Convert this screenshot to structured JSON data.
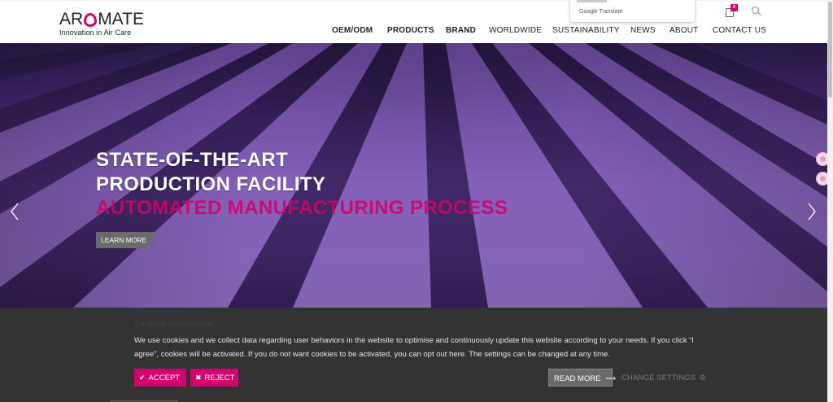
{
  "brand": {
    "logo_left": "AR",
    "logo_right": "MATE",
    "tagline": "Innovation in Air Care",
    "accent_color": "#d4006d"
  },
  "translate_popup": {
    "label": "Google Translate"
  },
  "header": {
    "cart_count": "0",
    "cart_icon": "cart-icon",
    "search_icon": "search-icon"
  },
  "nav": {
    "items": [
      {
        "label": "OEM/ODM"
      },
      {
        "label": "PRODUCTS"
      },
      {
        "label": "BRAND"
      },
      {
        "label": "WORLDWIDE"
      },
      {
        "label": "SUSTAINABILITY"
      },
      {
        "label": "NEWS"
      },
      {
        "label": "ABOUT"
      },
      {
        "label": "CONTACT US"
      }
    ]
  },
  "hero": {
    "title_line1": "STATE-OF-THE-ART",
    "title_line2": "PRODUCTION FACILITY",
    "subtitle": "AUTOMATED MANUFACTURING PROCESS",
    "cta": "LEARN MORE",
    "prev_icon": "chevron-left-icon",
    "next_icon": "chevron-right-icon"
  },
  "cookies": {
    "title": "Cookies Information",
    "text": "We use cookies and we collect data regarding user behaviors in the website to optimise and continuously update this website according to your needs. If you click “I agree”, cookies will be activated. If you do not want cookies to be activated, you can opt out here. The settings can be changed at any time.",
    "accept": "ACCEPT",
    "reject": "REJECT",
    "read_more": "READ MORE",
    "change_settings": "CHANGE SETTINGS"
  }
}
